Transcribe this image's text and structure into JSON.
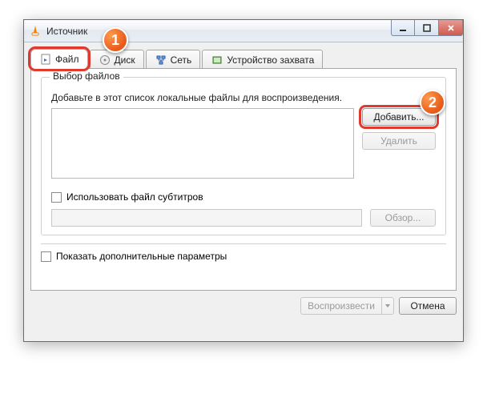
{
  "window": {
    "title": "Источник"
  },
  "tabs": {
    "file": {
      "label": "Файл"
    },
    "disc": {
      "label": "Диск"
    },
    "network": {
      "label": "Сеть"
    },
    "capture": {
      "label": "Устройство захвата"
    }
  },
  "file_panel": {
    "group_title": "Выбор файлов",
    "hint": "Добавьте в этот список локальные файлы для воспроизведения.",
    "add_label": "Добавить...",
    "remove_label": "Удалить",
    "use_subs_label": "Использовать файл субтитров",
    "browse_label": "Обзор..."
  },
  "bottom": {
    "more_options_label": "Показать дополнительные параметры"
  },
  "footer": {
    "play_label": "Воспроизвести",
    "cancel_label": "Отмена"
  },
  "callouts": {
    "one": "1",
    "two": "2"
  }
}
